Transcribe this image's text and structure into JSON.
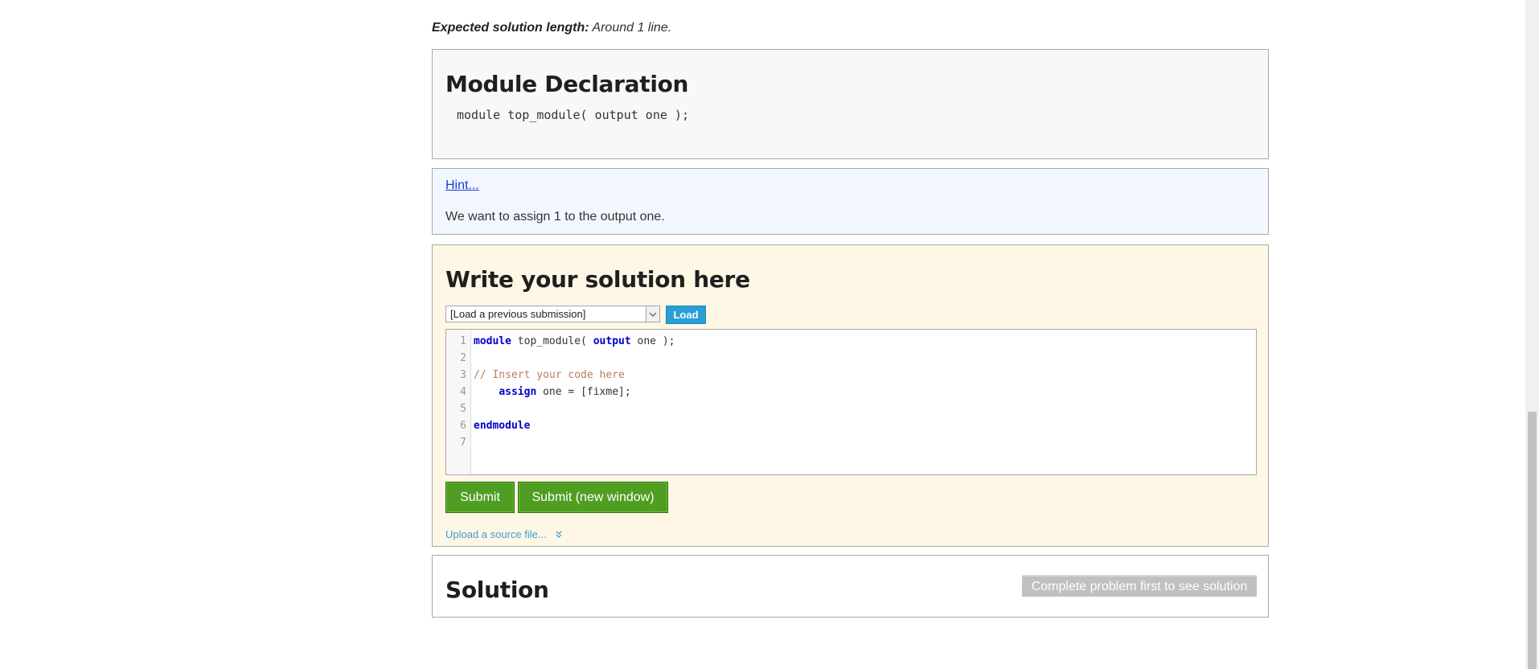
{
  "expected": {
    "label": "Expected solution length:",
    "value": " Around 1 line."
  },
  "declaration": {
    "title": "Module Declaration",
    "code": "module top_module( output one );"
  },
  "hint": {
    "link": "Hint...",
    "text": "We want to assign 1 to the output one."
  },
  "solution_editor": {
    "title": "Write your solution here",
    "select_value": "[Load a previous submission]",
    "load_label": "Load",
    "lines": [
      {
        "num": "1",
        "tokens": [
          {
            "t": "module",
            "c": "kw"
          },
          {
            "t": " top_module( ",
            "c": ""
          },
          {
            "t": "output",
            "c": "kw"
          },
          {
            "t": " one );",
            "c": ""
          }
        ]
      },
      {
        "num": "2",
        "tokens": []
      },
      {
        "num": "3",
        "tokens": [
          {
            "t": "// Insert your code here",
            "c": "cm"
          }
        ]
      },
      {
        "num": "4",
        "tokens": [
          {
            "t": "    ",
            "c": ""
          },
          {
            "t": "assign",
            "c": "kw"
          },
          {
            "t": " one = [fixme];",
            "c": ""
          }
        ]
      },
      {
        "num": "5",
        "tokens": []
      },
      {
        "num": "6",
        "tokens": [
          {
            "t": "endmodule",
            "c": "kw"
          }
        ]
      },
      {
        "num": "7",
        "tokens": []
      }
    ],
    "submit_label": "Submit",
    "submit_new_label": "Submit (new window)",
    "upload_label": "Upload a source file..."
  },
  "solution": {
    "title": "Solution",
    "button": "Complete problem first to see solution"
  },
  "colors": {
    "keyword": "#0000cc",
    "comment": "#b87e5c",
    "green_button": "#4f9e21",
    "load_button": "#2a9fd6"
  }
}
